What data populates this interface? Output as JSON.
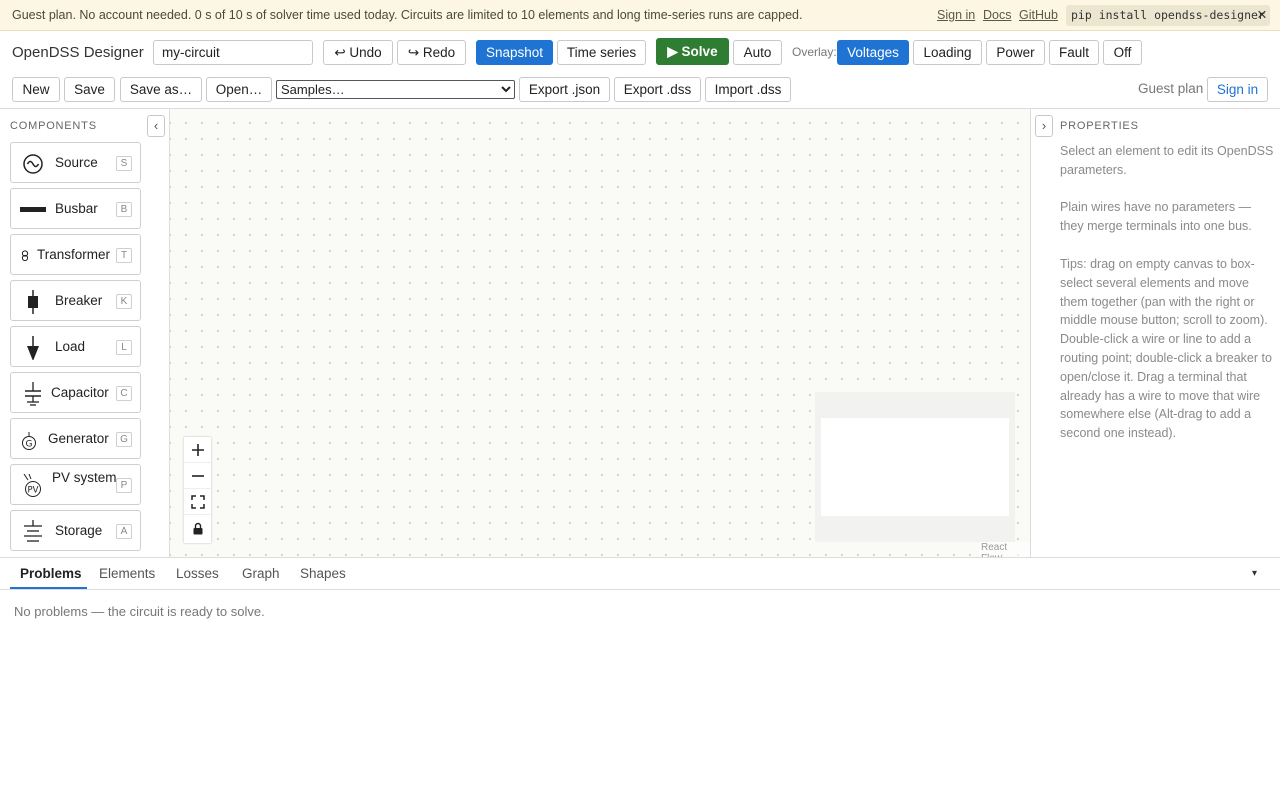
{
  "banner": {
    "message": "Guest plan. No account needed. 0 s of 10 s of solver time used today. Circuits are limited to 10 elements and long time-series runs are capped.",
    "sign_in": "Sign in",
    "docs": "Docs",
    "github": "GitHub",
    "pip_command": "pip install opendss-designer",
    "close": "×"
  },
  "toolbar": {
    "app_title": "OpenDSS Designer",
    "circuit_name": "my-circuit",
    "undo": "↩ Undo",
    "redo": "↪ Redo",
    "snapshot": "Snapshot",
    "time_series": "Time series",
    "solve": "▶ Solve",
    "auto": "Auto",
    "overlay_label": "Overlay:",
    "overlays": [
      "Voltages",
      "Loading",
      "Power",
      "Fault",
      "Off"
    ],
    "active_overlay": "Voltages",
    "new": "New",
    "save": "Save",
    "save_as": "Save as…",
    "open": "Open…",
    "samples": "Samples…",
    "export_json": "Export .json",
    "export_dss": "Export .dss",
    "import_dss": "Import .dss",
    "plan": "Guest plan",
    "sign_in": "Sign in"
  },
  "palette": {
    "header": "COMPONENTS",
    "collapse": "‹",
    "items": [
      {
        "label": "Source",
        "key": "S",
        "icon": "ac-source-icon"
      },
      {
        "label": "Busbar",
        "key": "B",
        "icon": "busbar-icon"
      },
      {
        "label": "Transformer",
        "key": "T",
        "icon": "transformer-icon"
      },
      {
        "label": "Breaker",
        "key": "K",
        "icon": "breaker-icon"
      },
      {
        "label": "Load",
        "key": "L",
        "icon": "load-icon"
      },
      {
        "label": "Capacitor",
        "key": "C",
        "icon": "capacitor-icon"
      },
      {
        "label": "Generator",
        "key": "G",
        "icon": "generator-icon"
      },
      {
        "label": "PV system",
        "key": "P",
        "icon": "pv-system-icon"
      },
      {
        "label": "Storage",
        "key": "A",
        "icon": "storage-icon"
      }
    ]
  },
  "canvas": {
    "attribution": "React Flow"
  },
  "properties": {
    "header": "PROPERTIES",
    "expand": "›",
    "select_hint": "Select an element to edit its OpenDSS parameters.",
    "wires_note": "Plain wires have no parameters — they merge terminals into one bus.",
    "tips": "Tips: drag on empty canvas to box-select several elements and move them together (pan with the right or middle mouse button; scroll to zoom). Double-click a wire or line to add a routing point; double-click a breaker to open/close it. Drag a terminal that already has a wire to move that wire somewhere else (Alt-drag to add a second one instead)."
  },
  "bottom": {
    "tabs": [
      "Problems",
      "Elements",
      "Losses",
      "Graph",
      "Shapes"
    ],
    "active_tab": "Problems",
    "message": "No problems — the circuit is ready to solve.",
    "caret": "▾"
  },
  "colors": {
    "accent": "#1f73d2",
    "solve": "#2e7d32",
    "banner_bg": "#fdf6e3"
  }
}
